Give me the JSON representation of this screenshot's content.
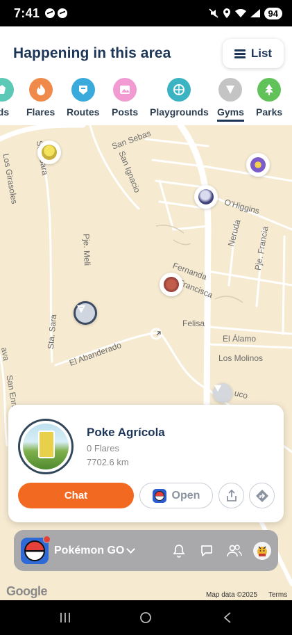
{
  "status_bar": {
    "time": "7:41",
    "battery": "94"
  },
  "header": {
    "title": "Happening in this area",
    "list_label": "List"
  },
  "categories": [
    {
      "label": "ids",
      "color": "#5cc9b7",
      "icon": "raid-icon"
    },
    {
      "label": "Flares",
      "color": "#f08a4b",
      "icon": "flare-icon"
    },
    {
      "label": "Routes",
      "color": "#3aa9dc",
      "icon": "route-icon"
    },
    {
      "label": "Posts",
      "color": "#f29ad2",
      "icon": "post-icon"
    },
    {
      "label": "Playgrounds",
      "color": "#3bb3c3",
      "icon": "playground-icon"
    },
    {
      "label": "Gyms",
      "color": "#c4c4c4",
      "icon": "gym-icon"
    },
    {
      "label": "Parks",
      "color": "#61c25a",
      "icon": "park-icon"
    }
  ],
  "map": {
    "streets": [
      "San Sebas",
      "Sta. Sara",
      "Los Girasoles",
      "San Ignacio",
      "O'Higgins",
      "Neruda",
      "Pje. Francia",
      "Pje. Meli",
      "Fernanda",
      "Francisca",
      "Felisa",
      "El Álamo",
      "Los Molinos",
      "El Abanderado",
      "Sta. Sara",
      "San Enrique",
      "uco",
      "ava"
    ],
    "map_credit": "Map data ©2025",
    "terms": "Terms",
    "google": "Google"
  },
  "place_card": {
    "name": "Poke Agrícola",
    "flares": "0 Flares",
    "distance": "7702.6 km",
    "chat_label": "Chat",
    "open_label": "Open"
  },
  "app_bar": {
    "app_name": "Pokémon GO"
  }
}
